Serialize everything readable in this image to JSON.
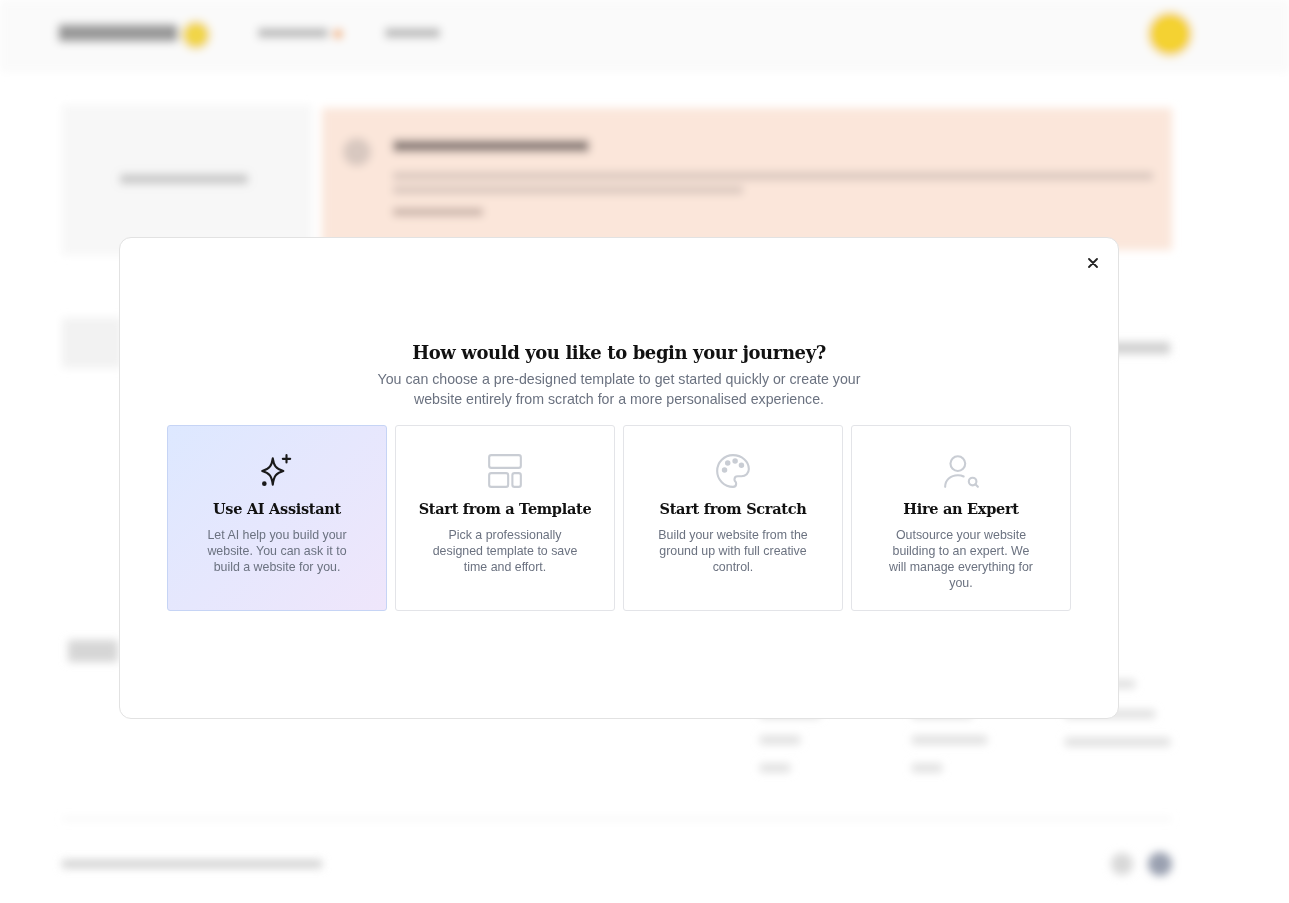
{
  "modal": {
    "title": "How would you like to begin your journey?",
    "subtitle": "You can choose a pre-designed template to get started quickly or create your website entirely from scratch for a more personalised experience.",
    "options": [
      {
        "kind": "sparkle",
        "title": "Use AI Assistant",
        "description": "Let AI help you build your website. You can ask it to build a website for you.",
        "selected": true
      },
      {
        "kind": "layout",
        "title": "Start from a Template",
        "description": "Pick a professionally designed template to save time and effort.",
        "selected": false
      },
      {
        "kind": "palette",
        "title": "Start from Scratch",
        "description": "Build your website from the ground up with full creative control.",
        "selected": false
      },
      {
        "kind": "person-search",
        "title": "Hire an Expert",
        "description": "Outsource your website building to an expert. We will manage everything for you.",
        "selected": false
      }
    ]
  }
}
